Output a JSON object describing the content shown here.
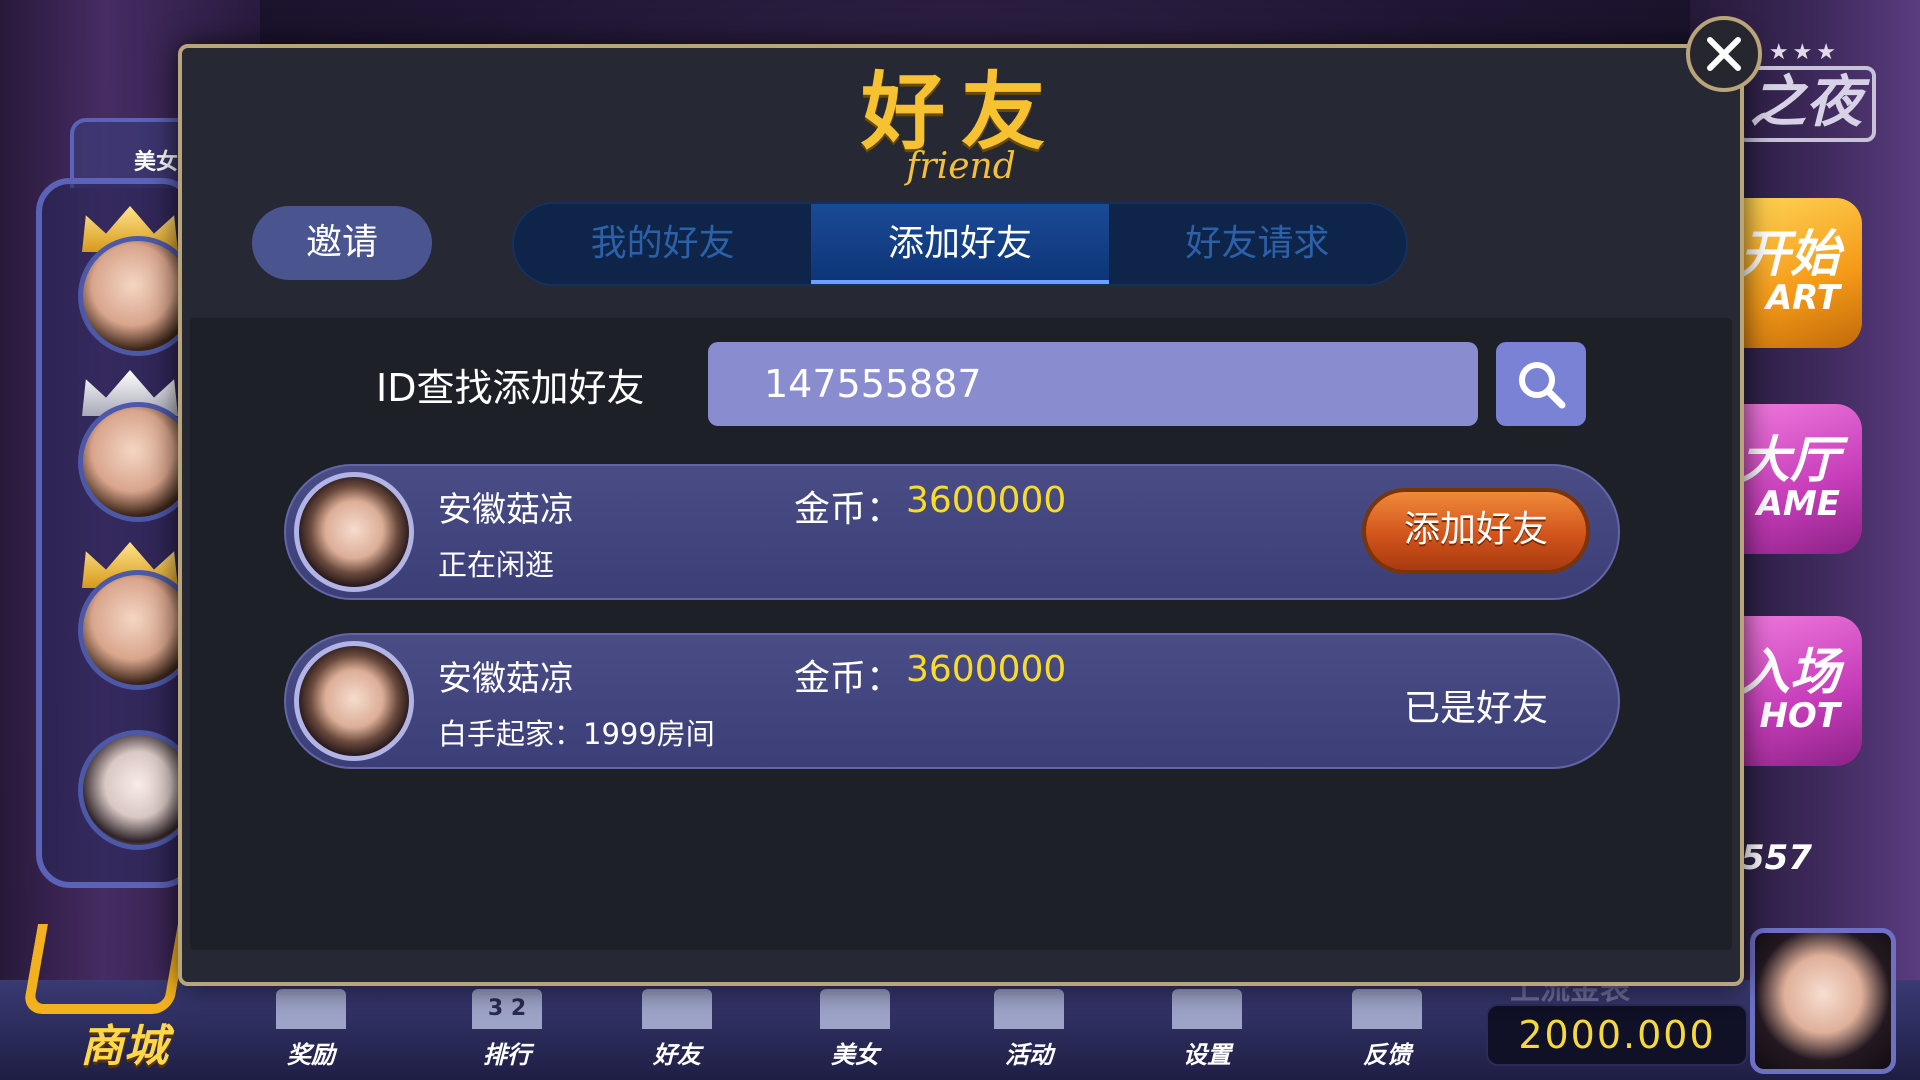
{
  "background": {
    "beauty_tab_label": "美女",
    "night_logo": "之夜",
    "night_stars": "★★★",
    "right_buttons": [
      {
        "big": "开始",
        "small": "ART"
      },
      {
        "big": "大厅",
        "small": "AME"
      },
      {
        "big": "入场",
        "small": "HOT"
      }
    ],
    "right_number": "557"
  },
  "bottom_nav": {
    "shop_label": "商城",
    "items": [
      {
        "label": "奖励",
        "icon": "gift-icon"
      },
      {
        "label": "排行",
        "icon": "ranking-icon",
        "icon_text": "3 2"
      },
      {
        "label": "好友",
        "icon": "friends-icon"
      },
      {
        "label": "美女",
        "icon": "beauty-icon"
      },
      {
        "label": "活动",
        "icon": "dice-icon"
      },
      {
        "label": "设置",
        "icon": "gear-icon"
      },
      {
        "label": "反馈",
        "icon": "mail-icon"
      }
    ],
    "coin_title": "上流金表",
    "coin_balance": "2000.000"
  },
  "modal": {
    "title": "好友",
    "subtitle": "friend",
    "invite_label": "邀请",
    "tabs": [
      {
        "label": "我的好友",
        "active": false
      },
      {
        "label": "添加好友",
        "active": true
      },
      {
        "label": "好友请求",
        "active": false
      }
    ],
    "search": {
      "label": "ID查找添加好友",
      "value": "147555887"
    },
    "results": [
      {
        "name": "安徽菇凉",
        "status": "正在闲逛",
        "coin_label": "金币：",
        "coin_value": "3600000",
        "action_label": "添加好友"
      },
      {
        "name": "安徽菇凉",
        "status": "白手起家：1999房间",
        "coin_label": "金币：",
        "coin_value": "3600000",
        "state_label": "已是好友"
      }
    ]
  },
  "colors": {
    "title_gold": "#f6c232",
    "coin_yellow": "#f8dc2a",
    "tab_active": "#1a4a96",
    "add_button": "#d2541c"
  }
}
